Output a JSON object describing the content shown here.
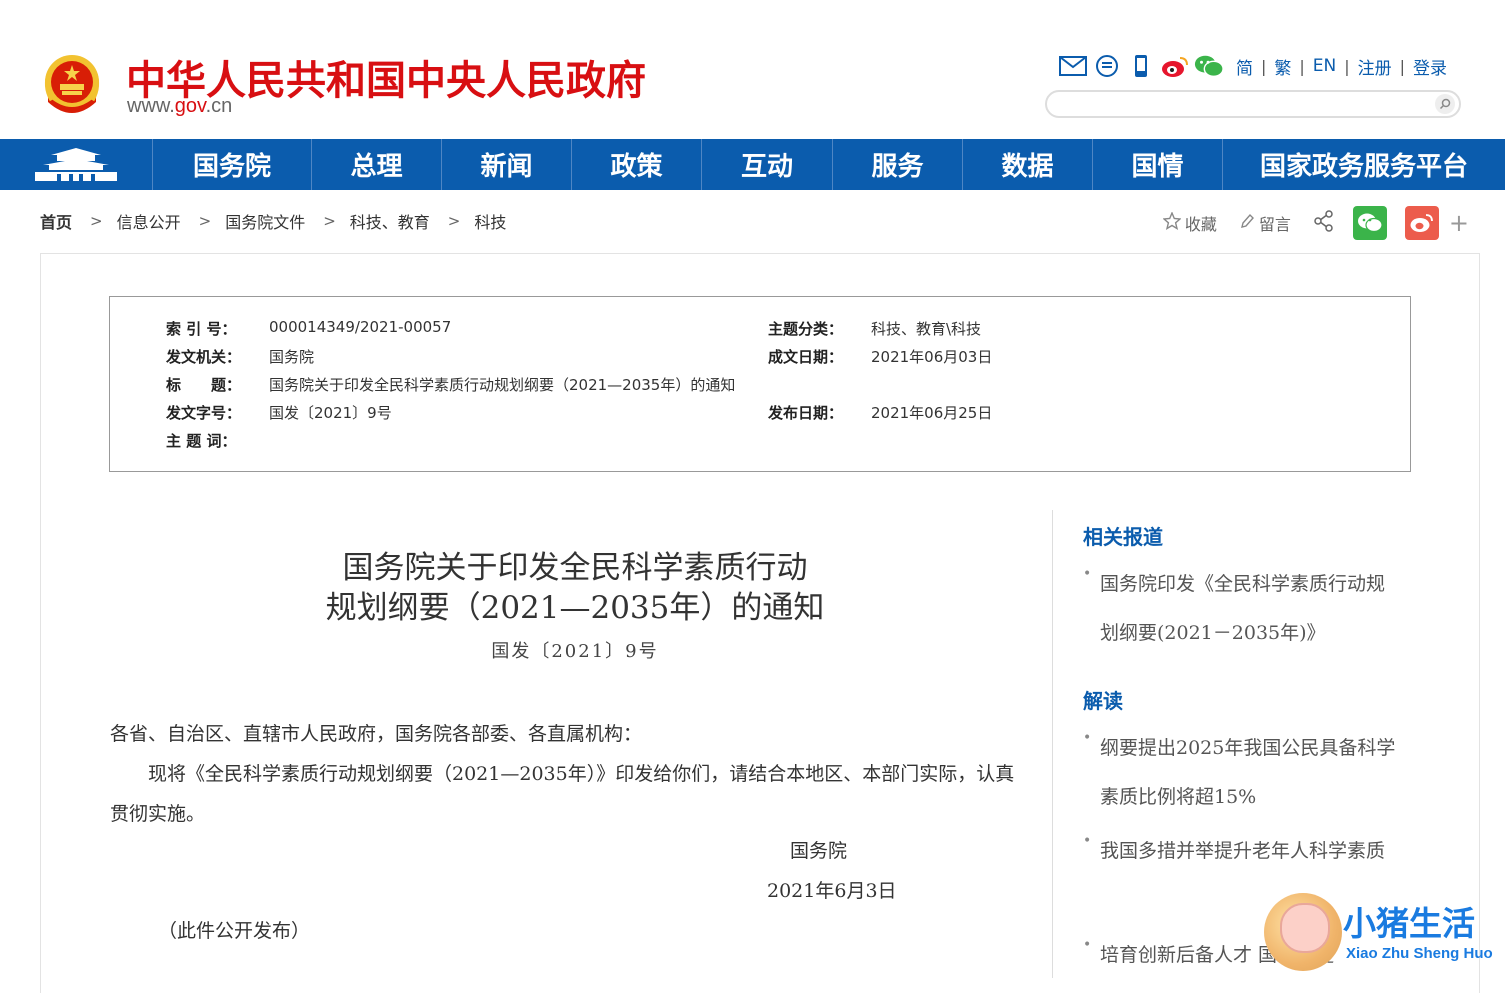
{
  "header": {
    "site_title": "中华人民共和国中央人民政府",
    "site_url_prefix": "www.",
    "site_url_gov": "gov",
    "site_url_suffix": ".cn",
    "lang_links": [
      "简",
      "繁",
      "EN",
      "注册",
      "登录"
    ],
    "tool_icons": [
      "mail-icon",
      "message-icon",
      "mobile-icon",
      "weibo-icon",
      "wechat-icon"
    ],
    "search": {
      "value": "",
      "placeholder": ""
    }
  },
  "nav": {
    "items": [
      "国务院",
      "总理",
      "新闻",
      "政策",
      "互动",
      "服务",
      "数据",
      "国情",
      "国家政务服务平台"
    ]
  },
  "breadcrumb": [
    "首页",
    "信息公开",
    "国务院文件",
    "科技、教育",
    "科技"
  ],
  "share": {
    "favorite": "收藏",
    "comment": "留言"
  },
  "meta": {
    "index_label": "索 引 号：",
    "index_value": "000014349/2021-00057",
    "category_label": "主题分类：",
    "category_value": "科技、教育\\科技",
    "issuer_label": "发文机关：",
    "issuer_value": "国务院",
    "written_label": "成文日期：",
    "written_value": "2021年06月03日",
    "title_label": "标　　题：",
    "title_value": "国务院关于印发全民科学素质行动规划纲要（2021—2035年）的通知",
    "docno_label": "发文字号：",
    "docno_value": "国发〔2021〕9号",
    "published_label": "发布日期：",
    "published_value": "2021年06月25日",
    "keywords_label": "主 题 词：",
    "keywords_value": ""
  },
  "article": {
    "title_line1": "国务院关于印发全民科学素质行动",
    "title_line2": "规划纲要（2021—2035年）的通知",
    "doc_no": "国发〔2021〕9号",
    "salutation": "各省、自治区、直辖市人民政府，国务院各部委、各直属机构：",
    "body": "现将《全民科学素质行动规划纲要（2021—2035年）》印发给你们，请结合本地区、本部门实际，认真贯彻实施。",
    "signature": "国务院",
    "date": "2021年6月3日",
    "note": "（此件公开发布）"
  },
  "sidebar": {
    "related_title": "相关报道",
    "related_items": [
      "国务院印发《全民科学素质行动规划纲要(2021－2035年)》"
    ],
    "interpret_title": "解读",
    "interpret_items": [
      "纲要提出2025年我国公民具备科学素质比例将超15%",
      "我国多措并举提升老年人科学素质",
      "培育创新后备人才 国者为提"
    ]
  },
  "watermark": {
    "cn": "小猪生活",
    "en": "Xiao Zhu Sheng Huo"
  },
  "colors": {
    "brand_red": "#d80f12",
    "nav_blue": "#0b5cad"
  }
}
